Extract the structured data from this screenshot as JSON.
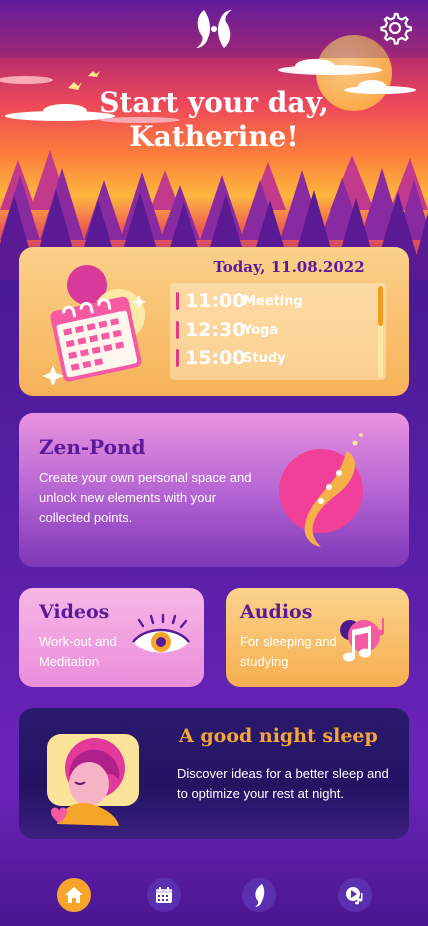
{
  "greeting": {
    "line1": "Start your day,",
    "line2": "Katherine!"
  },
  "header": {
    "logo_icon": "koi-fish-logo-icon",
    "settings_icon": "gear-icon"
  },
  "today": {
    "title": "Today, 11.08.2022",
    "icon": "calendar-icon",
    "schedule": [
      {
        "time": "11:00",
        "activity": "Meeting"
      },
      {
        "time": "12:30",
        "activity": "Yoga"
      },
      {
        "time": "15:00",
        "activity": "Study"
      }
    ],
    "scroll_position": 0.0
  },
  "zen_pond": {
    "title": "Zen-Pond",
    "description": "Create your own personal space and unlock new elements with your collected points.",
    "icon": "koi-fish-icon"
  },
  "videos": {
    "title": "Videos",
    "description": "Work-out and Meditation",
    "icon": "eye-icon"
  },
  "audios": {
    "title": "Audios",
    "description": "For sleeping and studying",
    "icon": "music-note-icon"
  },
  "sleep": {
    "title": "A good night sleep",
    "description": "Discover ideas for a better sleep and to optimize your rest at night.",
    "icon": "sleeping-person-icon"
  },
  "nav": {
    "items": [
      {
        "name": "home",
        "icon": "home-icon",
        "active": true
      },
      {
        "name": "calendar",
        "icon": "calendar-icon",
        "active": false
      },
      {
        "name": "zen-pond",
        "icon": "fish-icon",
        "active": false
      },
      {
        "name": "media",
        "icon": "play-music-icon",
        "active": false
      }
    ]
  },
  "colors": {
    "brand_purple": "#5b1a9a",
    "accent_orange": "#f6a52a",
    "highlight_pink": "#e23a7a"
  }
}
